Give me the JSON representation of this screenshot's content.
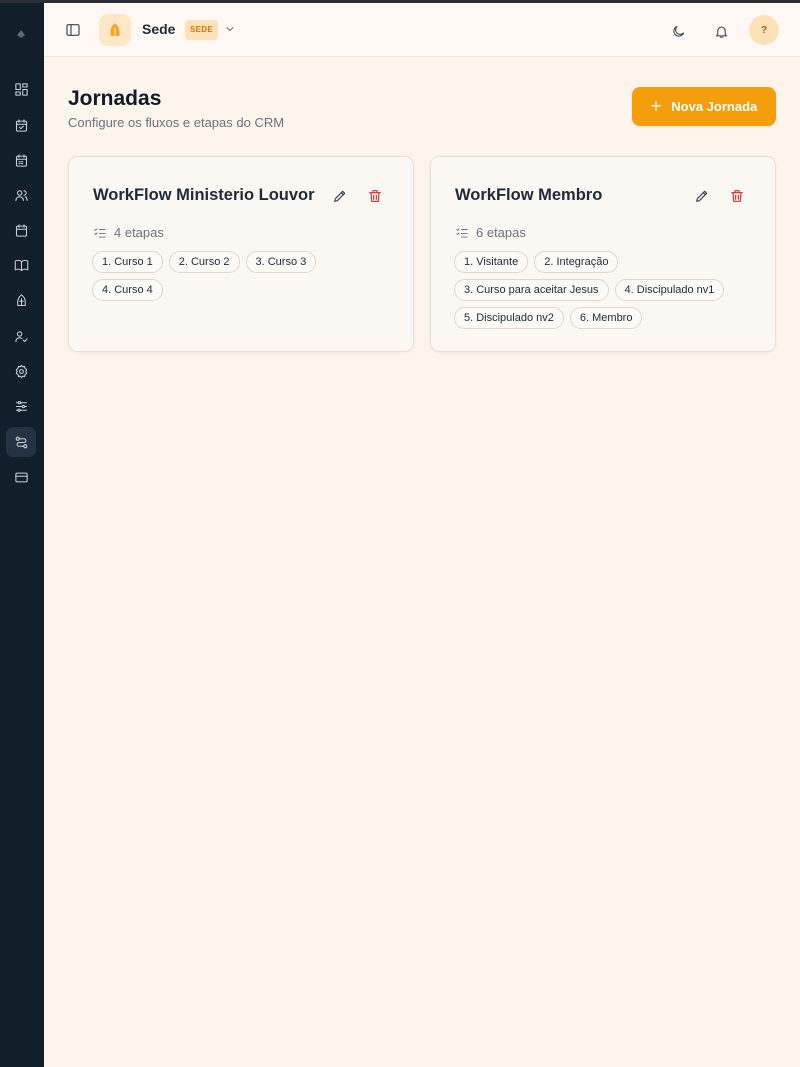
{
  "header": {
    "org_name": "Sede",
    "org_badge": "SEDE",
    "avatar_initial": "?"
  },
  "page": {
    "title": "Jornadas",
    "subtitle": "Configure os fluxos e etapas do CRM",
    "new_button_label": "Nova Jornada"
  },
  "journeys": [
    {
      "title": "WorkFlow Ministerio Louvor",
      "count_label": "4 etapas",
      "stages": [
        "1. Curso 1",
        "2. Curso 2",
        "3. Curso 3",
        "4. Curso 4"
      ]
    },
    {
      "title": "WorkFlow Membro",
      "count_label": "6 etapas",
      "stages": [
        "1. Visitante",
        "2. Integração",
        "3. Curso para aceitar Jesus",
        "4. Discipulado nv1",
        "5. Discipulado nv2",
        "6. Membro"
      ]
    }
  ],
  "sidebar": {
    "items": [
      {
        "icon": "dashboard-icon"
      },
      {
        "icon": "calendar-check-icon"
      },
      {
        "icon": "calendar-icon"
      },
      {
        "icon": "users-icon"
      },
      {
        "icon": "calendar-blank-icon"
      },
      {
        "icon": "book-icon"
      },
      {
        "icon": "church-icon"
      },
      {
        "icon": "user-check-icon"
      },
      {
        "icon": "settings-icon"
      },
      {
        "icon": "sliders-icon"
      },
      {
        "icon": "workflow-icon",
        "active": true
      },
      {
        "icon": "credit-card-icon"
      }
    ]
  },
  "colors": {
    "accent": "#f59e0b",
    "sidebar_bg": "#111f2b",
    "page_bg": "#fdf4ec",
    "delete": "#dc2626"
  }
}
